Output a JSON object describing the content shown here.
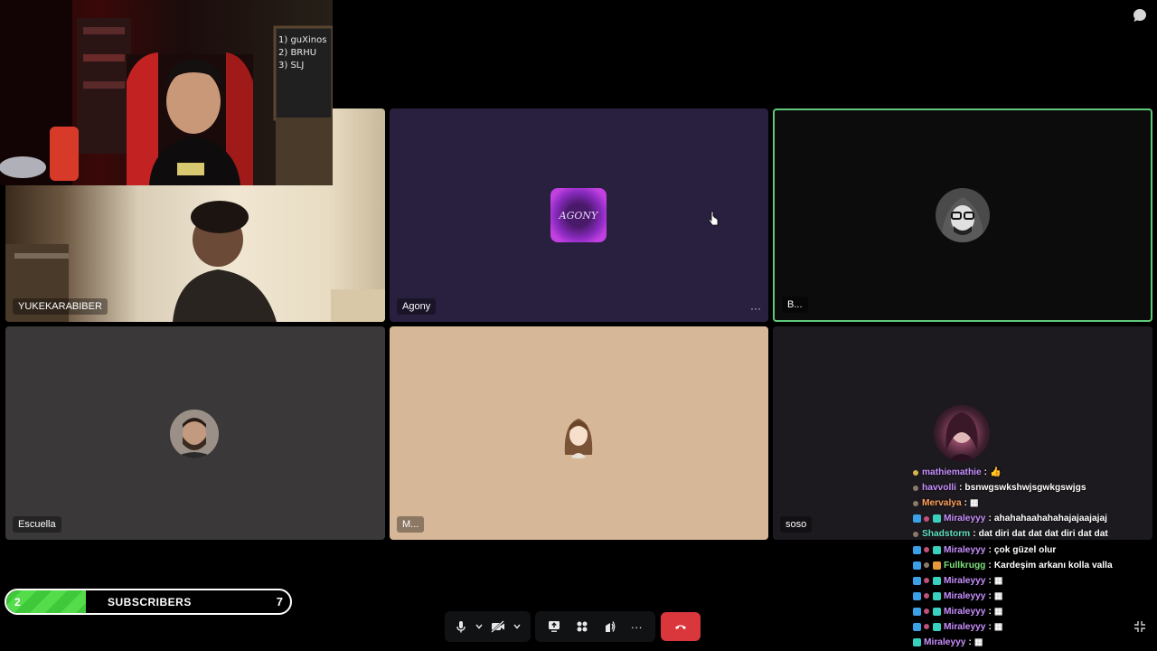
{
  "tiles": [
    {
      "name": "YUKEKARABIBER"
    },
    {
      "name": "Agony",
      "logo_text": "AGONY"
    },
    {
      "name": "B..."
    },
    {
      "name": "Escuella"
    },
    {
      "name": "M..."
    },
    {
      "name": "soso"
    }
  ],
  "webcam": {
    "board_text": "1) guXinos\n2) BRHU\n3) SLJ"
  },
  "subscribers": {
    "current": "2",
    "label": "SUBSCRIBERS",
    "goal": "7",
    "progress_fraction": 0.28
  },
  "toolbar": {
    "mic_icon": "microphone-icon",
    "camera_icon": "camera-off-icon",
    "screenshare_icon": "screen-share-icon",
    "activities_icon": "activities-icon",
    "soundboard_icon": "soundboard-icon",
    "more_icon": "more-options-icon",
    "hangup_icon": "hang-up-icon"
  },
  "tile_more_label": "···",
  "chat": [
    {
      "user": "mathiemathie",
      "color": "#c98fff",
      "text": "👍",
      "badges": [
        "yellow-dot"
      ]
    },
    {
      "user": "havvolli",
      "color": "#c98fff",
      "text": "bsnwgswkshwjsgwkgswjgs",
      "badges": [
        "grey-dot"
      ]
    },
    {
      "user": "Mervalya",
      "color": "#ff9f5a",
      "text": "▦",
      "badges": [
        "grey-dot"
      ]
    },
    {
      "user": "Miraleyyy",
      "color": "#c98fff",
      "text": "ahahahaahahahajajaajajaj",
      "badges": [
        "blue",
        "pink-dot",
        "teal"
      ]
    },
    {
      "user": "Shadstorm",
      "color": "#5fe0c2",
      "text": "dat diri dat dat dat diri dat dat",
      "badges": [
        "grey-dot"
      ]
    },
    {
      "user": "Miraleyyy",
      "color": "#c98fff",
      "text": "çok güzel olur",
      "badges": [
        "blue",
        "pink-dot",
        "teal"
      ]
    },
    {
      "user": "Fullkrugg",
      "color": "#7ee07a",
      "text": "Kardeşim arkanı kolla valla",
      "badges": [
        "blue",
        "grey-dot",
        "orange"
      ]
    },
    {
      "user": "Miraleyyy",
      "color": "#c98fff",
      "text": "▦",
      "badges": [
        "blue",
        "pink-dot",
        "teal"
      ]
    },
    {
      "user": "Miraleyyy",
      "color": "#c98fff",
      "text": "▦",
      "badges": [
        "blue",
        "pink-dot",
        "teal"
      ]
    },
    {
      "user": "Miraleyyy",
      "color": "#c98fff",
      "text": "▦",
      "badges": [
        "blue",
        "pink-dot",
        "teal"
      ]
    },
    {
      "user": "Miraleyyy",
      "color": "#c98fff",
      "text": "▦",
      "badges": [
        "blue",
        "pink-dot",
        "teal"
      ]
    },
    {
      "user": "Miraleyyy",
      "color": "#c98fff",
      "text": "▦",
      "badges": [
        "teal"
      ]
    }
  ],
  "colors": {
    "speaking_border": "#5fc97a",
    "hangup": "#da373c",
    "sub_fill": "#3fc93a"
  }
}
